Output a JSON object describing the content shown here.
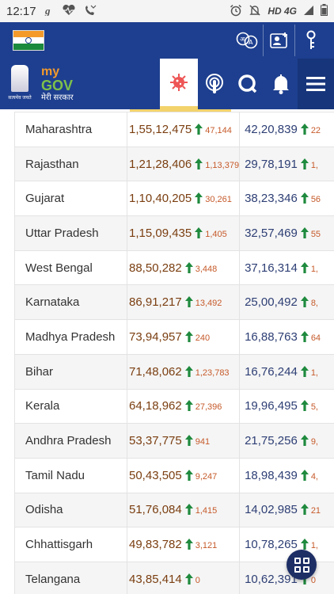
{
  "statusbar": {
    "time": "12:17",
    "network": "HD 4G"
  },
  "icons": {
    "status_left": [
      "g-app-icon",
      "heart-monitor-icon",
      "missed-call-icon"
    ],
    "status_right": [
      "alarm-icon",
      "mute-icon",
      "signal-icon",
      "battery-icon"
    ],
    "top": [
      "language-icon",
      "account-add-icon",
      "key-icon"
    ],
    "nav": [
      "covid-icon",
      "podcast-icon",
      "search-icon",
      "bell-icon",
      "hamburger-menu-icon"
    ]
  },
  "brand": {
    "emblem_caption": "सत्यमेव जयते",
    "logo_my": "my",
    "logo_gov": "GOV",
    "logo_sub": "मेरी सरकार"
  },
  "colors": {
    "primary": "#1e3f8f",
    "accent": "#f3d36b",
    "arrow": "#1f8a3e",
    "delta": "#c65a2a"
  },
  "table": {
    "rows": [
      {
        "state": "Maharashtra",
        "col1": "1,55,12,475",
        "d1": "47,144",
        "col2": "42,20,839",
        "d2": "22"
      },
      {
        "state": "Rajasthan",
        "col1": "1,21,28,406",
        "d1": "1,13,379",
        "col2": "29,78,191",
        "d2": "1,"
      },
      {
        "state": "Gujarat",
        "col1": "1,10,40,205",
        "d1": "30,261",
        "col2": "38,23,346",
        "d2": "56"
      },
      {
        "state": "Uttar Pradesh",
        "col1": "1,15,09,435",
        "d1": "1,405",
        "col2": "32,57,469",
        "d2": "55"
      },
      {
        "state": "West Bengal",
        "col1": "88,50,282",
        "d1": "3,448",
        "col2": "37,16,314",
        "d2": "1,"
      },
      {
        "state": "Karnataka",
        "col1": "86,91,217",
        "d1": "13,492",
        "col2": "25,00,492",
        "d2": "8,"
      },
      {
        "state": "Madhya Pradesh",
        "col1": "73,94,957",
        "d1": "240",
        "col2": "16,88,763",
        "d2": "64"
      },
      {
        "state": "Bihar",
        "col1": "71,48,062",
        "d1": "1,23,783",
        "col2": "16,76,244",
        "d2": "1,"
      },
      {
        "state": "Kerala",
        "col1": "64,18,962",
        "d1": "27,396",
        "col2": "19,96,495",
        "d2": "5,"
      },
      {
        "state": "Andhra Pradesh",
        "col1": "53,37,775",
        "d1": "941",
        "col2": "21,75,256",
        "d2": "9,"
      },
      {
        "state": "Tamil Nadu",
        "col1": "50,43,505",
        "d1": "9,247",
        "col2": "18,98,439",
        "d2": "4,"
      },
      {
        "state": "Odisha",
        "col1": "51,76,084",
        "d1": "1,415",
        "col2": "14,02,985",
        "d2": "21"
      },
      {
        "state": "Chhattisgarh",
        "col1": "49,83,782",
        "d1": "3,121",
        "col2": "10,78,265",
        "d2": "1,"
      },
      {
        "state": "Telangana",
        "col1": "43,85,414",
        "d1": "0",
        "col2": "10,62,391",
        "d2": "0"
      }
    ]
  }
}
